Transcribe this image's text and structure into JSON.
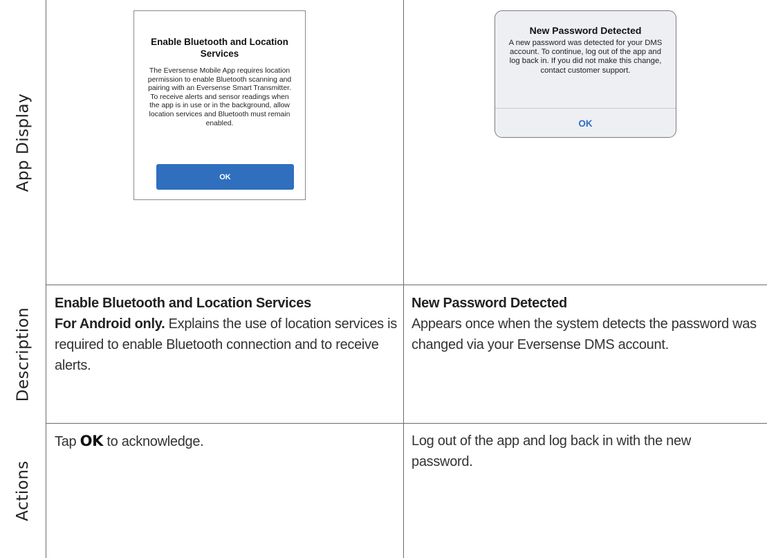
{
  "row_labels": {
    "app_display": "App Display",
    "description": "Description",
    "actions": "Actions"
  },
  "android_dialog": {
    "title": "Enable Bluetooth and Location Services",
    "body": "The Eversense Mobile App requires location permission to enable Bluetooth scanning and pairing with an Eversense Smart Transmitter. To receive alerts and sensor readings when the app is in use or in the background, allow location services and Bluetooth must remain enabled.",
    "button": "OK",
    "button_color": "#2f6fbe"
  },
  "ios_dialog": {
    "title": "New Password Detected",
    "body": "A new password was detected for your DMS account. To continue, log out of the app and log back in. If you did not make this change, contact customer support.",
    "button": "OK",
    "button_color": "#2b6fc9"
  },
  "descriptions": {
    "left": {
      "heading": "Enable Bluetooth and Location Services",
      "lead": "For Android only.",
      "text": " Explains the use of location services is required to enable Bluetooth connection and to receive alerts."
    },
    "right": {
      "heading": "New Password Detected",
      "text": "Appears once when the system detects the password was changed via your Eversense DMS account."
    }
  },
  "actions": {
    "left": {
      "pre": "Tap ",
      "key": "OK",
      "post": " to acknowledge."
    },
    "right": {
      "text": "Log out of the app and log back in with the new password."
    }
  }
}
